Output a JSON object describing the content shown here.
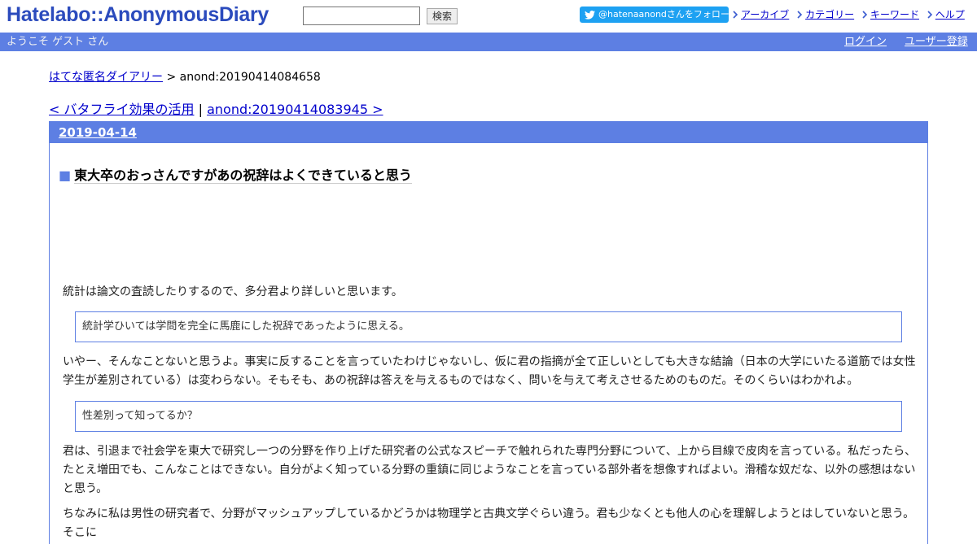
{
  "header": {
    "logo": "Hatelabo::AnonymousDiary",
    "search_placeholder": "",
    "search_button": "検索",
    "twitter_follow": "@hatenaanondさんをフォロー",
    "nav": [
      "アーカイブ",
      "カテゴリー",
      "キーワード",
      "ヘルプ"
    ]
  },
  "userbar": {
    "welcome": "ようこそ ゲスト さん",
    "login": "ログイン",
    "register": "ユーザー登録"
  },
  "breadcrumb": {
    "home": "はてな匿名ダイアリー",
    "separator": ">",
    "current": "anond:20190414084658"
  },
  "pager": {
    "prev": "< バタフライ効果の活用",
    "separator": "|",
    "next": "anond:20190414083945 >"
  },
  "day": {
    "date": "2019-04-14",
    "entry_marker": "■",
    "entry_title": "東大卒のおっさんですがあの祝辞はよくできていると思う"
  },
  "body": {
    "p1": "統計は論文の査読したりするので、多分君より詳しいと思います。",
    "quote1": "統計学ひいては学問を完全に馬鹿にした祝辞であったように思える。",
    "p2": "いやー、そんなことないと思うよ。事実に反することを言っていたわけじゃないし、仮に君の指摘が全て正しいとしても大きな結論（日本の大学にいたる道筋では女性学生が差別されている）は変わらない。そもそも、あの祝辞は答えを与えるものではなく、問いを与えて考えさせるためのものだ。そのくらいはわかれよ。",
    "quote2": "性差別って知ってるか？",
    "p3": "君は、引退まで社会学を東大で研究し一つの分野を作り上げた研究者の公式なスピーチで触れられた専門分野について、上から目線で皮肉を言っている。私だったら、たとえ増田でも、こんなことはできない。自分がよく知っている分野の重鎮に同じようなことを言っている部外者を想像すればよい。滑稽な奴だな、以外の感想はないと思う。",
    "p4": "ちなみに私は男性の研究者で、分野がマッシュアップしているかどうかは物理学と古典文学ぐらい違う。君も少なくとも他人の心を理解しようとはしていないと思う。そこに"
  },
  "colors": {
    "accent": "#5d7fe3",
    "logo": "#2b4bbd",
    "twitter": "#1da1f2",
    "link": "#0000cc"
  },
  "icons": {
    "twitter": "twitter-bird-icon",
    "nav_marker": "chevron-right-icon"
  }
}
